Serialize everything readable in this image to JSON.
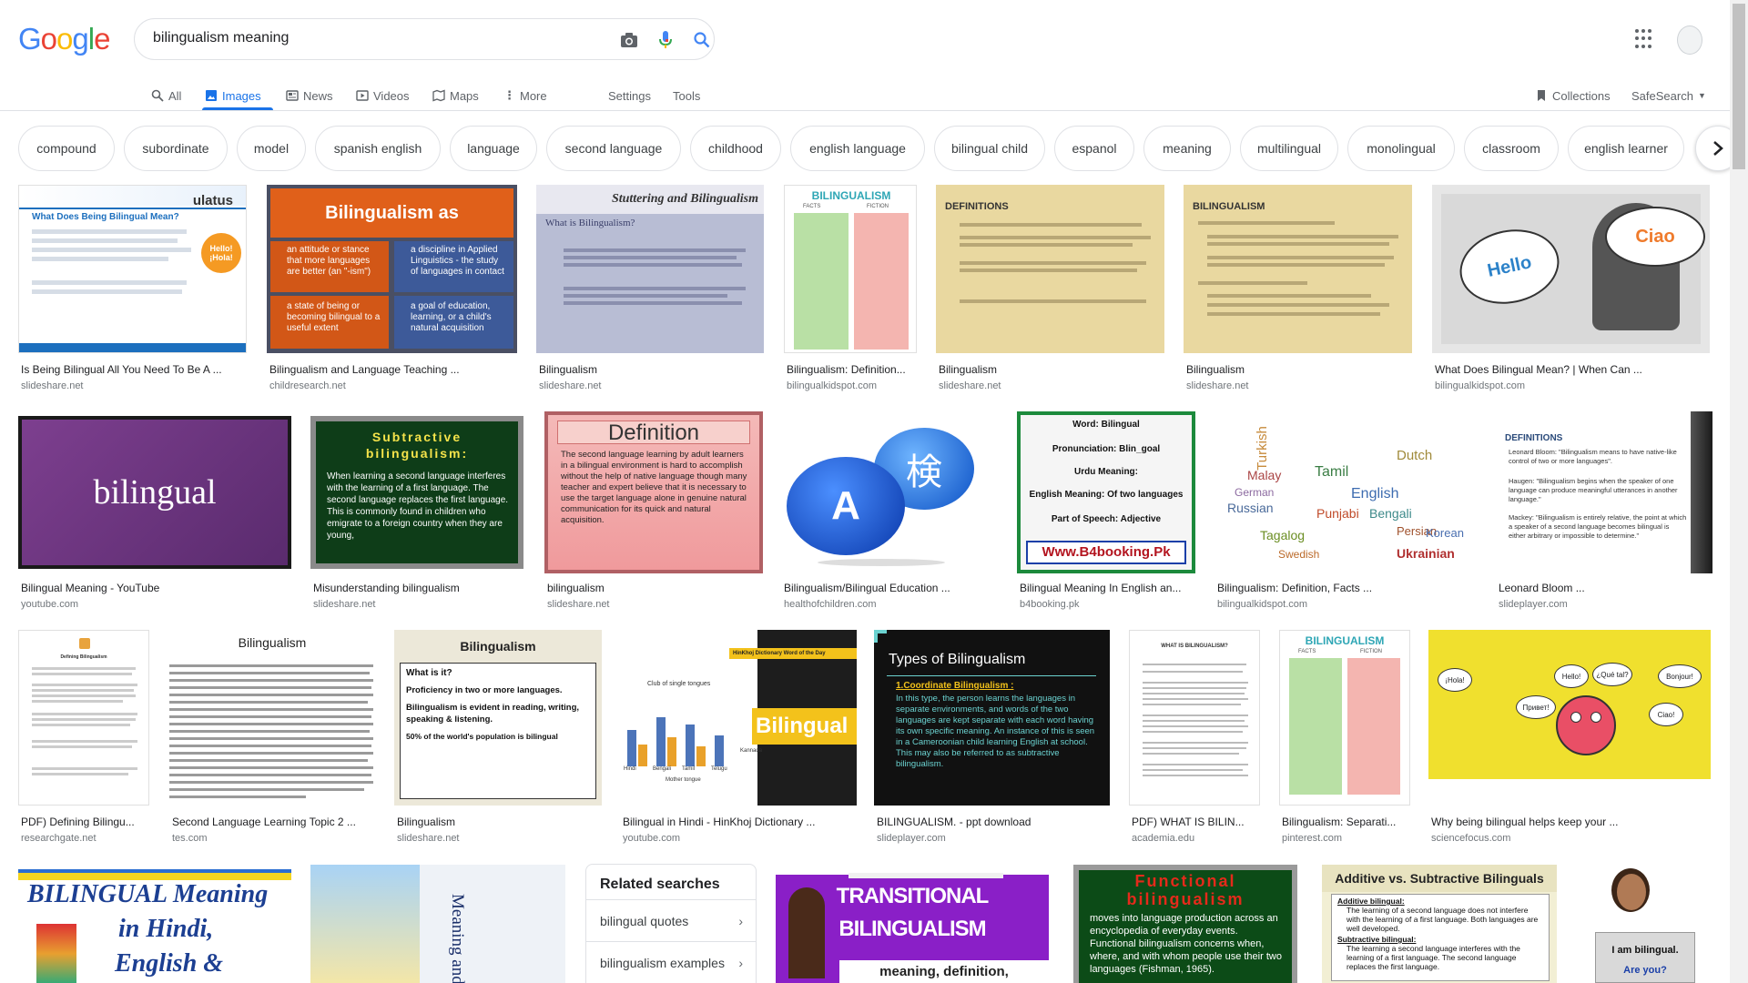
{
  "search": {
    "query": "bilingualism meaning"
  },
  "logo": "Google",
  "tabs": [
    {
      "label": "All"
    },
    {
      "label": "Images"
    },
    {
      "label": "News"
    },
    {
      "label": "Videos"
    },
    {
      "label": "Maps"
    },
    {
      "label": "More"
    },
    {
      "label": "Settings"
    },
    {
      "label": "Tools"
    }
  ],
  "right_tabs": {
    "collections": "Collections",
    "safesearch": "SafeSearch"
  },
  "chips": [
    "compound",
    "subordinate",
    "model",
    "spanish english",
    "language",
    "second language",
    "childhood",
    "english language",
    "bilingual child",
    "espanol",
    "meaning",
    "multilingual",
    "monolingual",
    "classroom",
    "english learner"
  ],
  "results": [
    {
      "title": "Is Being Bilingual All You Need To Be A ...",
      "source": "slideshare.net",
      "thumb_text": [
        "ulatus",
        "What Does Being Bilingual Mean?",
        "Hello! ¡Hola!"
      ]
    },
    {
      "title": "Bilingualism and Language Teaching ...",
      "source": "childresearch.net",
      "thumb_text": [
        "Bilingualism as",
        "an attitude or stance that more languages are better (an \"-ism\")",
        "a discipline in Applied Linguistics - the study of languages in contact",
        "a state of being or becoming bilingual to a useful extent",
        "a goal of education, learning, or a child's natural acquisition"
      ]
    },
    {
      "title": "Bilingualism",
      "source": "slideshare.net",
      "thumb_text": [
        "Stuttering and Bilingualism",
        "What is Bilingualism?"
      ]
    },
    {
      "title": "Bilingualism: Definition...",
      "source": "bilingualkidspot.com",
      "thumb_text": [
        "BILINGUALISM",
        "FACTS",
        "FICTION"
      ]
    },
    {
      "title": "Bilingualism",
      "source": "slideshare.net",
      "thumb_text": [
        "DEFINITIONS"
      ]
    },
    {
      "title": "Bilingualism",
      "source": "slideshare.net",
      "thumb_text": [
        "BILINGUALISM"
      ]
    },
    {
      "title": "What Does Bilingual Mean? | When Can ...",
      "source": "bilingualkidspot.com",
      "thumb_text": [
        "Hello",
        "Ciao"
      ]
    },
    {
      "title": "Bilingual Meaning - YouTube",
      "source": "youtube.com",
      "thumb_text": [
        "bilingual"
      ]
    },
    {
      "title": "Misunderstanding bilingualism",
      "source": "slideshare.net",
      "thumb_text": [
        "Subtractive bilingualism:",
        "When learning a second language interferes with the learning of a first language. The second language replaces the first language. This is commonly found in children who emigrate to a foreign country when they are young,"
      ]
    },
    {
      "title": "bilingualism",
      "source": "slideshare.net",
      "thumb_text": [
        "Definition",
        "The second language learning by adult learners in a bilingual environment is hard to accomplish without the help of native language though many teacher and expert believe that it is necessary to use the target language alone in genuine natural communication for its quick and natural acquisition."
      ]
    },
    {
      "title": "Bilingualism/Bilingual Education ...",
      "source": "healthofchildren.com",
      "thumb_text": [
        "A",
        "検"
      ]
    },
    {
      "title": "Bilingual Meaning In English an...",
      "source": "b4booking.pk",
      "thumb_text": [
        "Word: Bilingual",
        "Pronunciation: Blin_goal",
        "Urdu Meaning:",
        "English Meaning: Of two languages",
        "Part of Speech: Adjective",
        "Www.B4booking.Pk"
      ]
    },
    {
      "title": "Bilingualism: Definition, Facts ...",
      "source": "bilingualkidspot.com",
      "thumb_text": [
        "Turkish",
        "Malay",
        "German",
        "Russian",
        "Tamil",
        "English",
        "Dutch",
        "Punjabi",
        "Bengali",
        "Persian",
        "Tagalog",
        "Swedish",
        "Korean",
        "Ukrainian"
      ]
    },
    {
      "title": "Leonard Bloom ...",
      "source": "slideplayer.com",
      "thumb_text": [
        "DEFINITIONS",
        "Leonard Bloom: \"Bilingualism means to have native-like control of two or more languages\".",
        "Haugen: \"Bilingualism begins when the speaker of one language can produce meaningful utterances in another language.\"",
        "Mackey: \"Bilingualism is entirely relative, the point at which a speaker of a second language becomes bilingual is either arbitrary or impossible to determine.\""
      ]
    },
    {
      "title": "PDF) Defining Bilingu...",
      "source": "researchgate.net",
      "thumb_text": [
        "Defining Bilingualism"
      ]
    },
    {
      "title": "Second Language Learning Topic 2 ...",
      "source": "tes.com",
      "thumb_text": [
        "Bilingualism"
      ]
    },
    {
      "title": "Bilingualism",
      "source": "slideshare.net",
      "thumb_text": [
        "Bilingualism",
        "What is it?",
        "Proficiency in two or more languages.",
        "Bilingualism is evident in reading, writing, speaking & listening.",
        "50% of the world's population is bilingual"
      ]
    },
    {
      "title": "Bilingual in Hindi - HinKhoj Dictionary ...",
      "source": "youtube.com",
      "thumb_text": [
        "HinKhoj Dictionary Word of the Day",
        "Club of single tongues",
        "Bilingual",
        "Hindi",
        "Bengali",
        "Tamil",
        "Telugu",
        "Kannada",
        "Mother tongue"
      ]
    },
    {
      "title": "BILINGUALISM. - ppt download",
      "source": "slideplayer.com",
      "thumb_text": [
        "Types of Bilingualism",
        "1.Coordinate Bilingualism :",
        "In this type, the person learns the languages in separate environments, and words of the two languages are kept separate with each word having its own specific meaning. An instance of this is seen in a Cameroonian child learning English at school. This may also be referred to as subtractive bilingualism."
      ]
    },
    {
      "title": "PDF) WHAT IS BILIN...",
      "source": "academia.edu",
      "thumb_text": [
        "WHAT IS BILINGUALISM?"
      ]
    },
    {
      "title": "Bilingualism: Separati...",
      "source": "pinterest.com",
      "thumb_text": [
        "BILINGUALISM",
        "FACTS",
        "FICTION"
      ]
    },
    {
      "title": "Why being bilingual helps keep your ...",
      "source": "sciencefocus.com",
      "thumb_text": [
        "¡Hola!",
        "Hello!",
        "¿Qué tal?",
        "Bonjour!",
        "Ciao!",
        "Привет!"
      ]
    },
    {
      "title": "",
      "source": "",
      "thumb_text": [
        "BILINGUAL Meaning",
        "in Hindi,",
        "English &"
      ]
    },
    {
      "title": "",
      "source": "",
      "thumb_text": [
        "Meaning and Structure in Second Language Acquisition"
      ]
    },
    {
      "title": "",
      "source": "",
      "thumb_text": [
        "TRANSITIONAL",
        "BILINGUALISM",
        "meaning, definition, explanation..."
      ]
    },
    {
      "title": "",
      "source": "",
      "thumb_text": [
        "Functional bilingualism",
        "moves into language production across an encyclopedia of everyday events. Functional bilingualism concerns when, where, and with whom people use their two languages (Fishman, 1965)."
      ]
    },
    {
      "title": "",
      "source": "",
      "thumb_text": [
        "Additive vs. Subtractive Bilinguals",
        "Additive bilingual:",
        "The learning of a second language does not interfere with the learning of a first language. Both languages are well developed.",
        "Subtractive bilingual:",
        "The learning a second language interferes with the learning of a first language. The second language replaces the first language."
      ]
    },
    {
      "title": "",
      "source": "",
      "thumb_text": [
        "I am bilingual.",
        "Are you?"
      ]
    }
  ],
  "related": {
    "heading": "Related searches",
    "items": [
      {
        "label": "bilingual quotes"
      },
      {
        "label": "bilingualism examples"
      }
    ]
  },
  "colors": {
    "accent": "#1a73e8",
    "chip_border": "#dfe1e5",
    "source_gray": "#70757a"
  }
}
